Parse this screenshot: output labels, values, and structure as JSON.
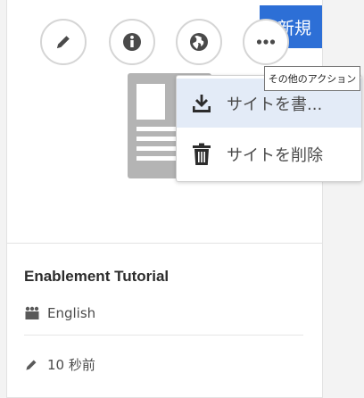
{
  "new_button": {
    "label": "新規"
  },
  "quick_actions": [
    {
      "name": "edit",
      "icon": "pencil-icon"
    },
    {
      "name": "properties",
      "icon": "info-icon"
    },
    {
      "name": "publish",
      "icon": "globe-icon"
    },
    {
      "name": "more-actions",
      "icon": "ellipsis-icon"
    }
  ],
  "tooltip": {
    "text": "その他のアクション"
  },
  "menu": {
    "items": [
      {
        "label": "サイトを書...",
        "icon": "download-icon",
        "highlighted": true
      },
      {
        "label": "サイトを削除",
        "icon": "trash-icon",
        "highlighted": false
      }
    ]
  },
  "card": {
    "title": "Enablement Tutorial",
    "language": "English",
    "modified": "10 秒前",
    "language_icon": "people-icon",
    "modified_icon": "pencil-icon"
  },
  "colors": {
    "accent": "#2d6fd6",
    "menu_highlight": "#e3ebf7"
  }
}
